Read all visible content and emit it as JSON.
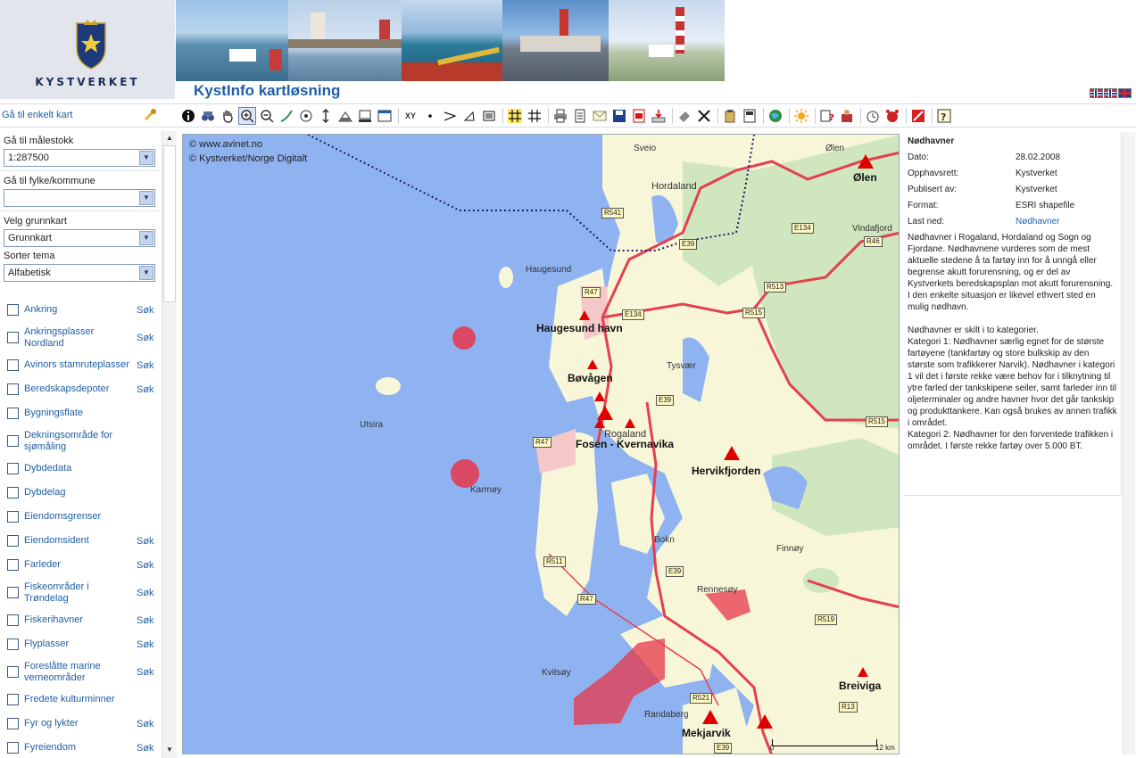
{
  "header": {
    "logo_text": "KYSTVERKET",
    "app_title": "KystInfo kartløsning",
    "photos": [
      "harbor-boats-photo",
      "lighthouse-dock-photo",
      "oil-boom-photo",
      "lighthouse-rocks-photo",
      "lighthouse-island-photo"
    ],
    "flags": [
      "norway-flag",
      "norway-flag",
      "uk-flag"
    ]
  },
  "toolbar": {
    "goto_map_label": "Gå til enkelt kart",
    "xy_label": "XY"
  },
  "sidebar": {
    "scale_label": "Gå til målestokk",
    "scale_value": "1:287500",
    "county_label": "Gå til fylke/kommune",
    "county_value": "",
    "basemap_label": "Velg grunnkart",
    "basemap_value": "Grunnkart",
    "sort_label": "Sorter tema",
    "sort_value": "Alfabetisk",
    "layers": [
      {
        "name": "Ankring",
        "sok": "Søk"
      },
      {
        "name": "Ankringsplasser Nordland",
        "sok": "Søk"
      },
      {
        "name": "Avinors stamruteplasser",
        "sok": "Søk"
      },
      {
        "name": "Beredskapsdepoter",
        "sok": "Søk"
      },
      {
        "name": "Bygningsflate",
        "sok": ""
      },
      {
        "name": "Dekningsområde for sjømåling",
        "sok": ""
      },
      {
        "name": "Dybdedata",
        "sok": ""
      },
      {
        "name": "Dybdelag",
        "sok": ""
      },
      {
        "name": "Eiendomsgrenser",
        "sok": ""
      },
      {
        "name": "Eiendomsident",
        "sok": "Søk"
      },
      {
        "name": "Farleder",
        "sok": "Søk"
      },
      {
        "name": "Fiskeområder i Trøndelag",
        "sok": "Søk"
      },
      {
        "name": "Fiskerihavner",
        "sok": "Søk"
      },
      {
        "name": "Flyplasser",
        "sok": "Søk"
      },
      {
        "name": "Foreslåtte marine verneområder",
        "sok": "Søk"
      },
      {
        "name": "Fredete kulturminner",
        "sok": ""
      },
      {
        "name": "Fyr og lykter",
        "sok": "Søk"
      },
      {
        "name": "Fyreiendom",
        "sok": "Søk"
      }
    ]
  },
  "map": {
    "copyright_1": "© www.avinet.no",
    "copyright_2": "© Kystverket/Norge Digitalt",
    "places": {
      "sveio": "Sveio",
      "olen_small": "Ølen",
      "hordaland": "Hordaland",
      "vindafjord": "Vindafjord",
      "haugesund": "Haugesund",
      "tysvaer": "Tysvær",
      "utsira": "Utsira",
      "rogaland": "Rogaland",
      "karmoy": "Karmøy",
      "bokn": "Bokn",
      "finnoy": "Finnøy",
      "rennesoy": "Rennesøy",
      "kvitsoy": "Kvitsøy",
      "randaberg": "Randaberg"
    },
    "harbors": {
      "olen": "Ølen",
      "haugesund_havn": "Haugesund havn",
      "bovagen": "Bøvågen",
      "fosen": "Fosen - Kvernavika",
      "hervikfjorden": "Hervikfjorden",
      "breiviga": "Breiviga",
      "mekjarvik": "Mekjarvik"
    },
    "roads": {
      "r541": "R541",
      "e39a": "E39",
      "e134a": "E134",
      "r46": "R46",
      "r47a": "R47",
      "e134b": "E134",
      "r513": "R513",
      "r515a": "R515",
      "e39b": "E39",
      "r515b": "R515",
      "r47b": "R47",
      "r511": "R511",
      "e39c": "E39",
      "r47c": "R47",
      "r519": "R519",
      "r521": "R521",
      "r13": "R13",
      "e39d": "E39"
    },
    "scale_min": "0",
    "scale_max": "12 km"
  },
  "info": {
    "title": "Nødhavner",
    "meta": [
      {
        "k": "Dato:",
        "v": "28.02.2008"
      },
      {
        "k": "Opphavsrett:",
        "v": "Kystverket"
      },
      {
        "k": "Publisert av:",
        "v": "Kystverket"
      },
      {
        "k": "Format:",
        "v": "ESRI shapefile"
      },
      {
        "k": "Last ned:",
        "v": "Nødhavner"
      }
    ],
    "desc_1": "Nødhavner i Rogaland, Hordaland og Sogn og Fjordane. Nødhavnene vurderes som de mest aktuelle stedene å ta fartøy inn for å unngå eller begrense akutt forurensning, og er del av Kystverkets beredskapsplan mot akutt forurensning. I den enkelte situasjon er likevel ethvert sted en mulig nødhavn.",
    "desc_2": "Nødhavner er skilt i to kategorier.",
    "desc_3": "Kategori 1: Nødhavner særlig egnet for de største fartøyene (tankfartøy og store bulkskip av den største som trafikkerer Narvik). Nødhavner i kategori 1 vil det i første rekke være behov for i tilknytning til ytre farled der tankskipene seiler, samt farleder inn til oljeterminaler og andre havner hvor det går tankskip og produkttankere. Kan også brukes av annen trafikk i området.",
    "desc_4": "Kategori 2: Nødhavner for den forventede trafikken i området. I første rekke fartøy over 5.000 BT."
  },
  "colors": {
    "water": "#8fb3f0",
    "land": "#f8f6d8",
    "forest": "#cfe6bf",
    "road": "#e4404f",
    "urban": "#f4c8c8",
    "accent": "#1f5fa6"
  }
}
